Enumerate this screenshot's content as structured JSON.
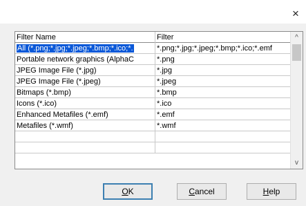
{
  "window": {
    "close_glyph": "×"
  },
  "table": {
    "columns": [
      "Filter Name",
      "Filter"
    ],
    "rows": [
      {
        "name": "All (*.png;*.jpg;*.jpeg;*.bmp;*.ico;*.",
        "filter": "*.png;*.jpg;*.jpeg;*.bmp;*.ico;*.emf",
        "selected": true
      },
      {
        "name": "Portable network graphics (AlphaC",
        "filter": "*.png"
      },
      {
        "name": "JPEG Image File (*.jpg)",
        "filter": "*.jpg"
      },
      {
        "name": "JPEG Image File (*.jpeg)",
        "filter": "*.jpeg"
      },
      {
        "name": "Bitmaps (*.bmp)",
        "filter": "*.bmp"
      },
      {
        "name": "Icons (*.ico)",
        "filter": "*.ico"
      },
      {
        "name": "Enhanced Metafiles (*.emf)",
        "filter": "*.emf"
      },
      {
        "name": "Metafiles (*.wmf)",
        "filter": "*.wmf"
      },
      {
        "name": "",
        "filter": ""
      },
      {
        "name": "",
        "filter": ""
      }
    ]
  },
  "scrollbar": {
    "up_glyph": "^",
    "down_glyph": "v"
  },
  "buttons": {
    "ok": {
      "accel": "O",
      "rest": "K"
    },
    "cancel": {
      "accel": "C",
      "rest": "ancel"
    },
    "help": {
      "accel": "H",
      "rest": "elp"
    }
  },
  "colors": {
    "selection": "#0a58d8",
    "default_button_border": "#3c7fb1"
  }
}
